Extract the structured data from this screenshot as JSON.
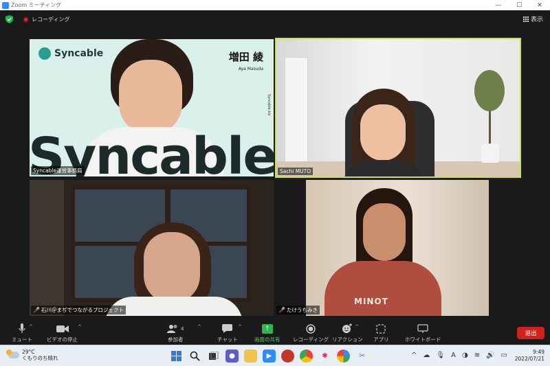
{
  "window": {
    "title": "Zoom ミーティング",
    "controls": [
      "—",
      "☐",
      "✕"
    ]
  },
  "meeting_bar": {
    "recording_label": "レコーディング",
    "view_label": "表示"
  },
  "tiles": [
    {
      "name": "Syncable運営事務局",
      "muted": false,
      "background_brand": "Syncable",
      "speaker_name_jp": "増田 綾",
      "speaker_name_en": "Aya Masuda",
      "vertical_url": "Syncable.biz",
      "big_text": "Syncable",
      "active_speaker": false
    },
    {
      "name": "Sachi MUTO",
      "muted": false,
      "active_speaker": true,
      "highlight_color": "#c8e04d"
    },
    {
      "name": "石川＠まぢでつながるプロジェクト",
      "muted": true,
      "active_speaker": false
    },
    {
      "name": "たけうちみき",
      "muted": true,
      "active_speaker": false,
      "shirt_text": "MINOT"
    }
  ],
  "toolbar": {
    "mute_label": "ミュート",
    "video_label": "ビデオの停止",
    "participants_label": "参加者",
    "participants_count": "4",
    "chat_label": "チャット",
    "share_label": "画面の共有",
    "record_label": "レコーディング",
    "reaction_label": "リアクション",
    "apps_label": "アプリ",
    "whiteboard_label": "ホワイトボード",
    "leave_label": "退出",
    "leave_color": "#d0231f",
    "share_color": "#2fb34c"
  },
  "taskbar": {
    "weather_temp": "29°C",
    "weather_desc": "くもりのち晴れ",
    "time": "9:49",
    "date": "2022/07/21",
    "ime_label": "A"
  }
}
